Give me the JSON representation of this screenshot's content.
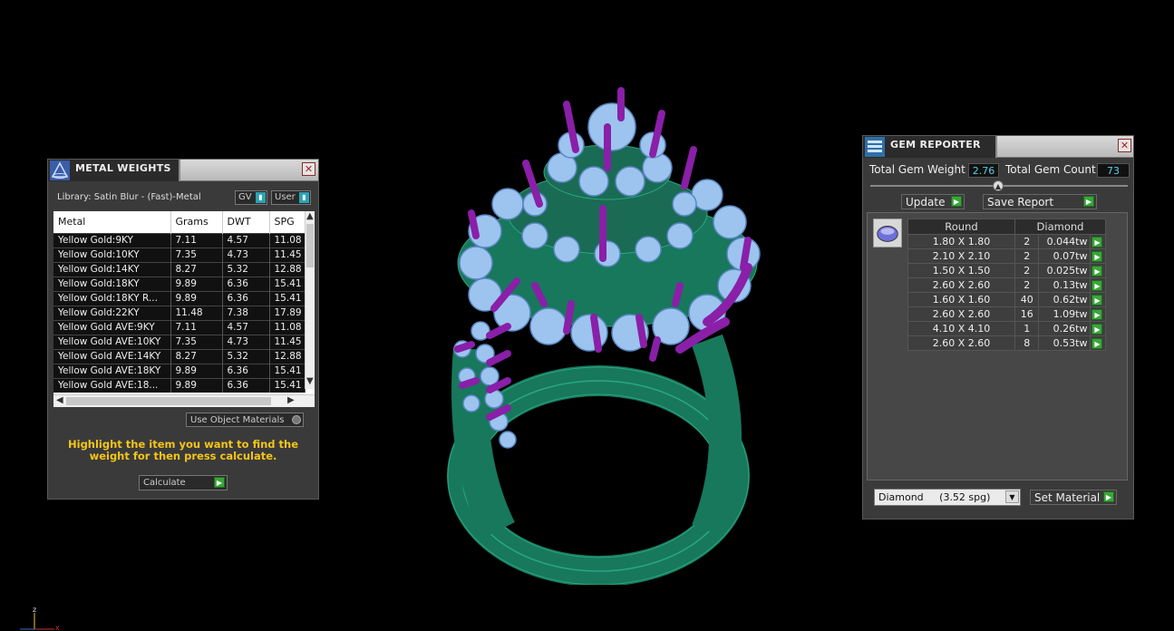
{
  "metal_weights": {
    "title": "METAL WEIGHTS",
    "library_label": "Library: Satin Blur - (Fast)-Metal",
    "toggle_gv": "GV",
    "toggle_user": "User",
    "columns": [
      "Metal",
      "Grams",
      "DWT",
      "SPG"
    ],
    "rows": [
      [
        "Yellow Gold:9KY",
        "7.11",
        "4.57",
        "11.08"
      ],
      [
        "Yellow Gold:10KY",
        "7.35",
        "4.73",
        "11.45"
      ],
      [
        "Yellow Gold:14KY",
        "8.27",
        "5.32",
        "12.88"
      ],
      [
        "Yellow Gold:18KY",
        "9.89",
        "6.36",
        "15.41"
      ],
      [
        "Yellow Gold:18KY R...",
        "9.89",
        "6.36",
        "15.41"
      ],
      [
        "Yellow Gold:22KY",
        "11.48",
        "7.38",
        "17.89"
      ],
      [
        "Yellow Gold AVE:9KY",
        "7.11",
        "4.57",
        "11.08"
      ],
      [
        "Yellow Gold AVE:10KY",
        "7.35",
        "4.73",
        "11.45"
      ],
      [
        "Yellow Gold AVE:14KY",
        "8.27",
        "5.32",
        "12.88"
      ],
      [
        "Yellow Gold AVE:18KY",
        "9.89",
        "6.36",
        "15.41"
      ],
      [
        "Yellow Gold AVE:18...",
        "9.89",
        "6.36",
        "15.41"
      ]
    ],
    "use_object_materials": "Use Object Materials",
    "hint": "Highlight the item you want to find the weight for then press calculate.",
    "calculate_label": "Calculate"
  },
  "gem_reporter": {
    "title": "GEM REPORTER",
    "total_gem_weight_label": "Total Gem Weight",
    "total_gem_weight": "2.76",
    "total_gem_count_label": "Total Gem Count",
    "total_gem_count": "73",
    "update_label": "Update",
    "save_report_label": "Save Report",
    "table_header": [
      "Round",
      "Diamond"
    ],
    "gems": [
      {
        "size": "1.80 X 1.80",
        "count": "2",
        "weight": "0.044tw"
      },
      {
        "size": "2.10 X 2.10",
        "count": "2",
        "weight": "0.07tw"
      },
      {
        "size": "1.50 X 1.50",
        "count": "2",
        "weight": "0.025tw"
      },
      {
        "size": "2.60 X 2.60",
        "count": "2",
        "weight": "0.13tw"
      },
      {
        "size": "1.60 X 1.60",
        "count": "40",
        "weight": "0.62tw"
      },
      {
        "size": "2.60 X 2.60",
        "count": "16",
        "weight": "1.09tw"
      },
      {
        "size": "4.10 X 4.10",
        "count": "1",
        "weight": "0.26tw"
      },
      {
        "size": "2.60 X 2.60",
        "count": "8",
        "weight": "0.53tw"
      }
    ],
    "material_select": "Diamond     (3.52 spg)",
    "set_material_label": "Set Material"
  },
  "close_glyph": "✕",
  "colors": {
    "ring_metal": "#17785c",
    "prongs": "#8a1fa8",
    "gems": "#9cc4ee",
    "hint_text": "#f5c518"
  }
}
